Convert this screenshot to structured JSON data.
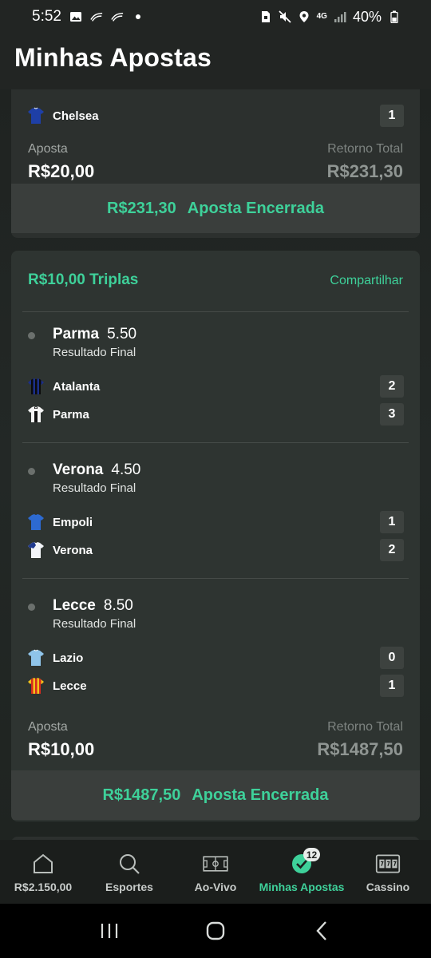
{
  "status_bar": {
    "time": "5:52",
    "battery": "40%",
    "network": "4G",
    "left_icons": [
      "image-icon",
      "swoosh-icon",
      "swoosh-icon",
      "dot-icon"
    ],
    "right_icons": [
      "sim-icon",
      "mute-icon",
      "location-icon",
      "network-icon",
      "signal-icon",
      "battery-icon"
    ]
  },
  "header": {
    "title": "Minhas Apostas"
  },
  "bets": [
    {
      "team": {
        "name": "Chelsea",
        "score": "1",
        "jersey_color": "#1e3fa6"
      },
      "stake_label": "Aposta",
      "stake": "R$20,00",
      "return_label": "Retorno Total",
      "return": "R$231,30",
      "settled_amount": "R$231,30",
      "settled_status": "Aposta Encerrada"
    },
    {
      "title": "R$10,00 Triplas",
      "share_label": "Compartilhar",
      "selections": [
        {
          "pick": "Parma",
          "odd": "5.50",
          "market": "Resultado Final",
          "teams": [
            {
              "name": "Atalanta",
              "score": "2",
              "jersey": "atalanta-jersey-icon"
            },
            {
              "name": "Parma",
              "score": "3",
              "jersey": "parma-jersey-icon"
            }
          ]
        },
        {
          "pick": "Verona",
          "odd": "4.50",
          "market": "Resultado Final",
          "teams": [
            {
              "name": "Empoli",
              "score": "1",
              "jersey": "empoli-jersey-icon"
            },
            {
              "name": "Verona",
              "score": "2",
              "jersey": "verona-jersey-icon"
            }
          ]
        },
        {
          "pick": "Lecce",
          "odd": "8.50",
          "market": "Resultado Final",
          "teams": [
            {
              "name": "Lazio",
              "score": "0",
              "jersey": "lazio-jersey-icon"
            },
            {
              "name": "Lecce",
              "score": "1",
              "jersey": "lecce-jersey-icon"
            }
          ]
        }
      ],
      "stake_label": "Aposta",
      "stake": "R$10,00",
      "return_label": "Retorno Total",
      "return": "R$1487,50",
      "settled_amount": "R$1487,50",
      "settled_status": "Aposta Encerrada"
    }
  ],
  "bottom_nav": [
    {
      "label": "R$2.150,00",
      "icon": "home-icon",
      "active": false
    },
    {
      "label": "Esportes",
      "icon": "search-icon",
      "active": false
    },
    {
      "label": "Ao-Vivo",
      "icon": "pitch-icon",
      "active": false
    },
    {
      "label": "Minhas Apostas",
      "icon": "check-circle-icon",
      "active": true,
      "badge": "12"
    },
    {
      "label": "Cassino",
      "icon": "slot-machine-icon",
      "active": false
    }
  ],
  "colors": {
    "accent": "#3ed19a",
    "card": "#2e3431",
    "background": "#222523"
  }
}
